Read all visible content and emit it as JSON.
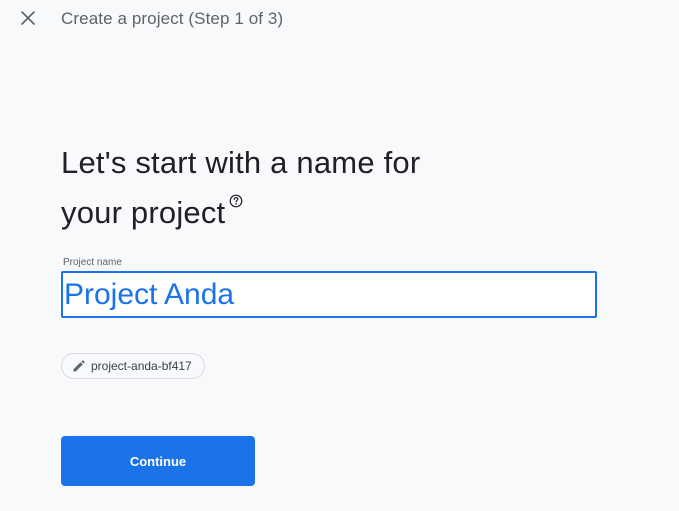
{
  "header": {
    "close_icon": "close-icon",
    "title": "Create a project (Step 1 of 3)"
  },
  "main": {
    "heading_line1": "Let's start with a name for",
    "heading_line2": "your project",
    "help_icon": "help-circle-icon",
    "project_name_label": "Project name",
    "project_name_value": "Project Anda",
    "project_id_icon": "pencil-icon",
    "project_id": "project-anda-bf417",
    "continue_label": "Continue"
  },
  "colors": {
    "accent": "#1a73e8",
    "background": "#f8f9fa",
    "text_primary": "#202124",
    "text_secondary": "#5f6368"
  }
}
